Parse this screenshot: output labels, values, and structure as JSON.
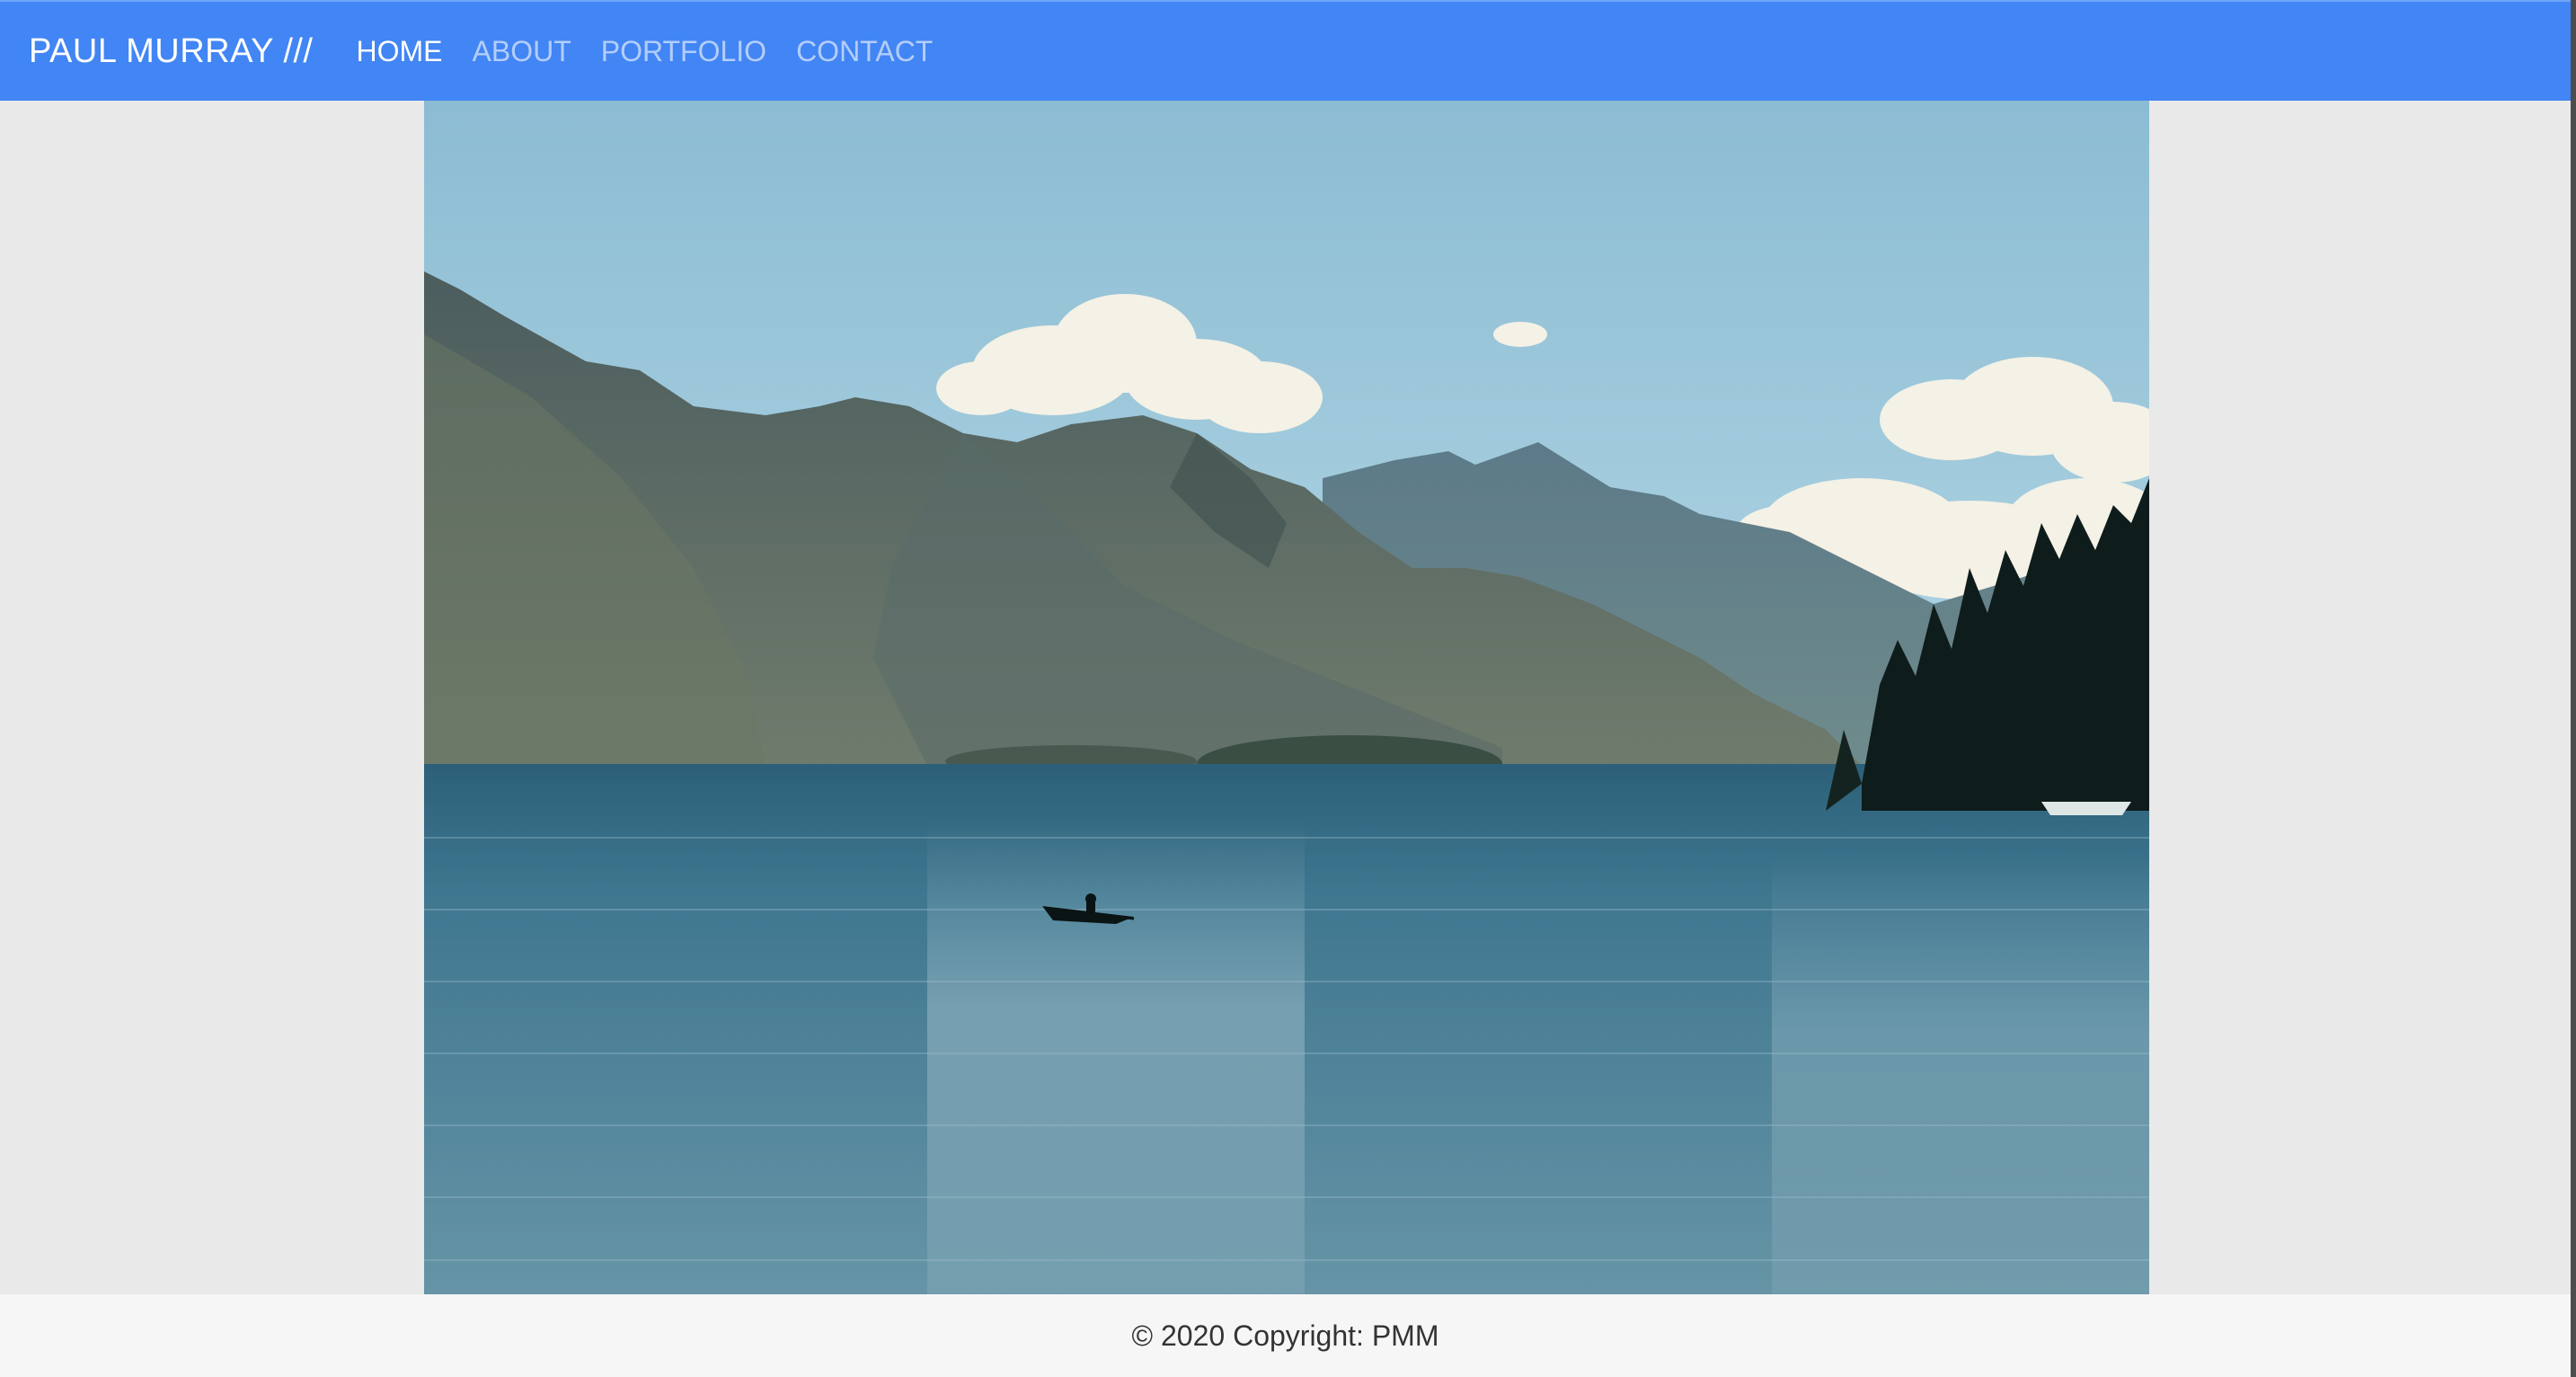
{
  "navbar": {
    "brand": "PAUL MURRAY ///",
    "links": [
      {
        "label": "HOME",
        "active": true
      },
      {
        "label": "ABOUT",
        "active": false
      },
      {
        "label": "PORTFOLIO",
        "active": false
      },
      {
        "label": "CONTACT",
        "active": false
      }
    ]
  },
  "hero": {
    "subject": "mountain lake landscape photo with kayaker",
    "colors": {
      "sky_top": "#8fbdd4",
      "sky_bottom": "#a9cfdf",
      "mountain_far": "#6e8a9a",
      "mountain_near": "#5a6d68",
      "water_top": "#2f6580",
      "water_bottom": "#5f8fa3",
      "trees": "#0f1d1c"
    }
  },
  "footer": {
    "copyright": "© 2020 Copyright: PMM"
  },
  "theme": {
    "navbar_bg": "#4285f4",
    "page_bg": "#e9e9e9",
    "footer_bg": "#f6f6f6"
  }
}
